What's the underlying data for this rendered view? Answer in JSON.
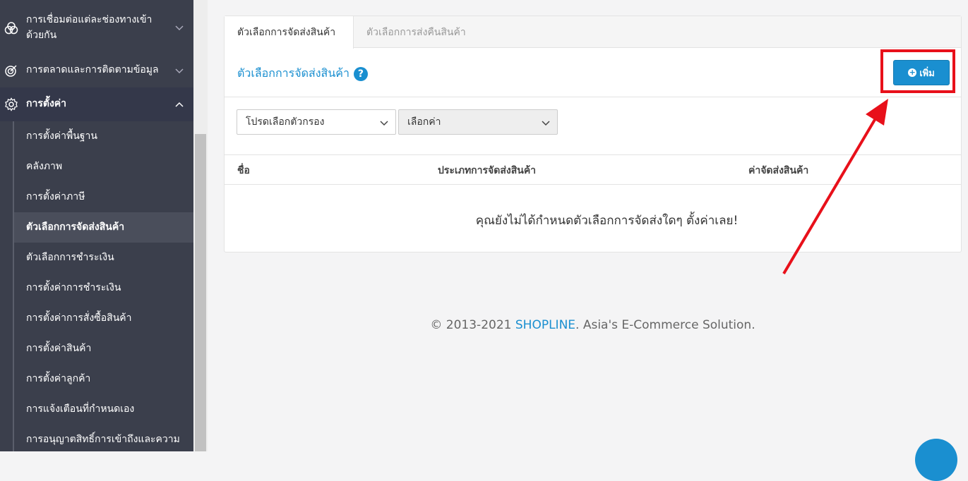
{
  "sidebar": {
    "groups": [
      {
        "icon": "link-circles-icon",
        "label_line1": "การเชื่อมต่อแต่ละช่องทางเข้า",
        "label_line2": "ด้วยกัน"
      },
      {
        "icon": "target-icon",
        "label": "การตลาดและการติดตามข้อมูล"
      },
      {
        "icon": "gear-icon",
        "label": "การตั้งค่า"
      }
    ],
    "sub_items": [
      "การตั้งค่าพื้นฐาน",
      "คลังภาพ",
      "การตั้งค่าภาษี",
      "ตัวเลือกการจัดส่งสินค้า",
      "ตัวเลือกการชำระเงิน",
      "การตั้งค่าการชำระเงิน",
      "การตั้งค่าการสั่งซื้อสินค้า",
      "การตั้งค่าสินค้า",
      "การตั้งค่าลูกค้า",
      "การแจ้งเตือนที่กำหนดเอง",
      "การอนุญาตสิทธิ์การเข้าถึงและความ"
    ],
    "active_sub_index": 3
  },
  "tabs": [
    {
      "label": "ตัวเลือกการจัดส่งสินค้า"
    },
    {
      "label": "ตัวเลือกการส่งคืนสินค้า"
    }
  ],
  "panel": {
    "title": "ตัวเลือกการจัดส่งสินค้า",
    "help_glyph": "?",
    "add_button_label": "เพิ่ม",
    "plus_glyph": "+"
  },
  "filters": {
    "filter_select": "โปรดเลือกตัวกรอง",
    "value_select": "เลือกค่า"
  },
  "table": {
    "headers": [
      "ชื่อ",
      "ประเภทการจัดส่งสินค้า",
      "ค่าจัดส่งสินค้า"
    ],
    "empty_message": "คุณยังไม่ได้กำหนดตัวเลือกการจัดส่งใดๆ ตั้งค่าเลย!"
  },
  "footer": {
    "prefix": "© 2013-2021 ",
    "brand": "SHOPLINE",
    "suffix": ". Asia's E-Commerce Solution."
  },
  "colors": {
    "accent": "#1a8fd0",
    "sidebar_bg": "#3b3f4c",
    "annotation_red": "#e8101a"
  }
}
